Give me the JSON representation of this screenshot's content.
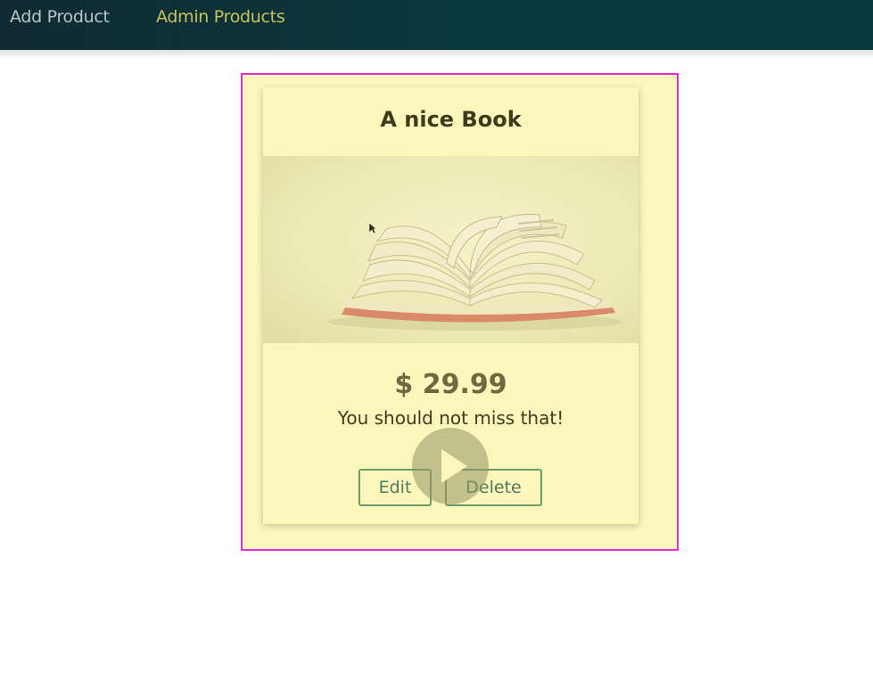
{
  "nav": {
    "items": [
      {
        "label": "Add Product"
      },
      {
        "label": "Admin Products"
      }
    ]
  },
  "product": {
    "title": "A nice Book",
    "image_icon": "open-book-image",
    "price": "$ 29.99",
    "description": "You should not miss that!"
  },
  "actions": {
    "edit_label": "Edit",
    "delete_label": "Delete"
  },
  "overlay": {
    "play_icon": "play-icon"
  },
  "colors": {
    "topbar": "#0b3a3e",
    "active_nav": "#c9c25a",
    "card_bg": "#fbf6bb",
    "highlight_border": "#e52ad3",
    "button_border": "#6b9a6b"
  }
}
